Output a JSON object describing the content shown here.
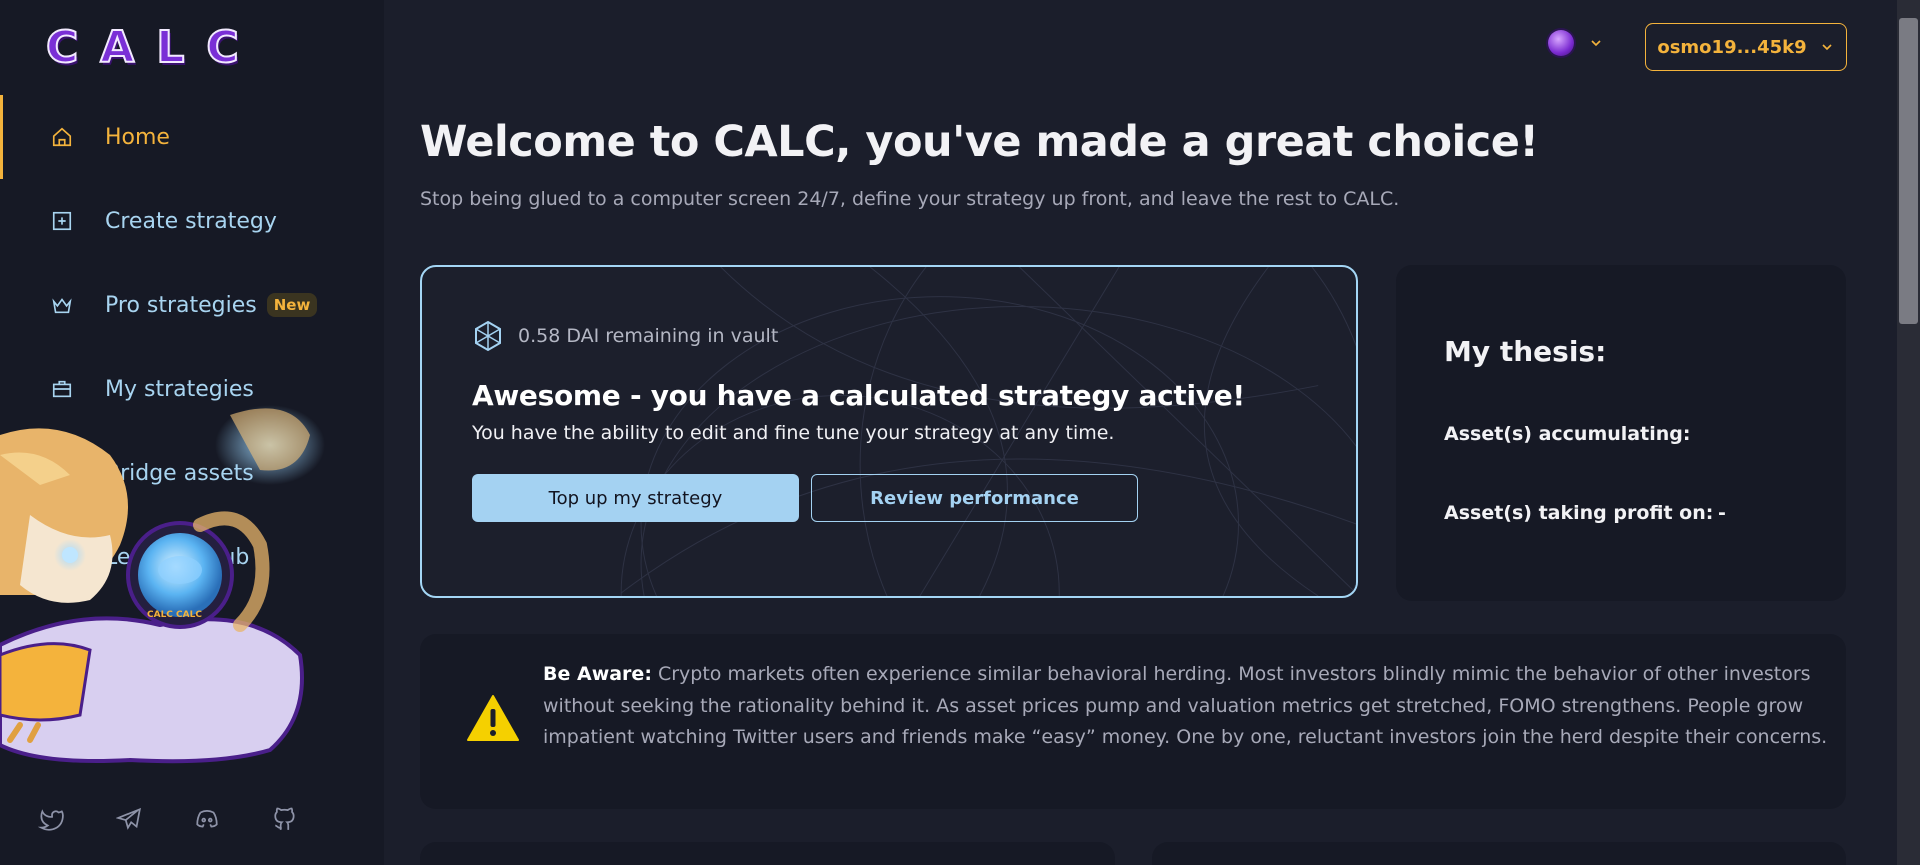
{
  "app": {
    "logo_text": "CALC",
    "accent": "#f4b33c",
    "link_color": "#a8d4f0"
  },
  "sidebar": {
    "items": [
      {
        "label": "Home",
        "icon": "home-icon",
        "active": true
      },
      {
        "label": "Create strategy",
        "icon": "plus-square-icon",
        "active": false
      },
      {
        "label": "Pro strategies",
        "icon": "crown-icon",
        "active": false,
        "badge": "New"
      },
      {
        "label": "My strategies",
        "icon": "briefcase-icon",
        "active": false
      },
      {
        "label": "Bridge assets",
        "icon": "external-link-icon",
        "active": false
      },
      {
        "label": "Learning hub",
        "icon": "book-icon",
        "active": false
      }
    ],
    "socials": [
      "twitter-icon",
      "telegram-icon",
      "discord-icon",
      "github-icon"
    ],
    "mascot_coin_text": "CALC CALC"
  },
  "header": {
    "network_icon": "osmosis-icon",
    "wallet_address": "osmo19...45k9"
  },
  "main": {
    "title": "Welcome to CALC, you've made a great choice!",
    "subtitle": "Stop being glued to a computer screen 24/7, define your strategy up front, and leave the rest to CALC.",
    "vault": {
      "remaining": "0.58 DAI remaining in vault",
      "heading": "Awesome - you have a calculated strategy active!",
      "description": "You have the ability to edit and fine tune your strategy at any time.",
      "primary_button": "Top up my strategy",
      "secondary_button": "Review performance"
    },
    "thesis": {
      "title": "My thesis:",
      "accumulating_label": "Asset(s) accumulating:",
      "accumulating_value": "",
      "profit_label": "Asset(s) taking profit on:",
      "profit_value": "-"
    },
    "aware": {
      "label": "Be Aware:",
      "text": "Crypto markets often experience similar behavioral herding. Most investors blindly mimic the behavior of other investors without seeking the rationality behind it. As asset prices pump and valuation metrics get stretched, FOMO strengthens. People grow impatient watching Twitter users and friends make “easy” money. One by one, reluctant investors join the herd despite their concerns."
    }
  }
}
